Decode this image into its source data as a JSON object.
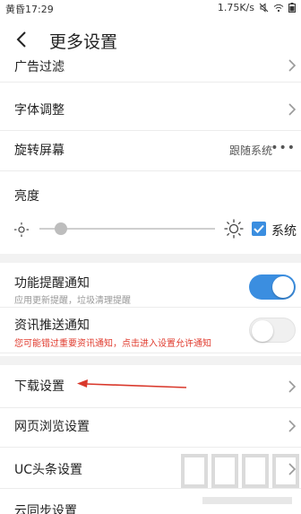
{
  "status_bar": {
    "time": "黄昏17:29",
    "speed": "1.75K/s"
  },
  "header": {
    "title": "更多设置"
  },
  "rows_top": [
    {
      "label": "广告过滤"
    },
    {
      "label": "字体调整"
    },
    {
      "label": "旋转屏幕",
      "value": "跟随系统",
      "dots": "•••"
    }
  ],
  "brightness": {
    "label": "亮度",
    "level": 0.12,
    "follow_system_label": "系统",
    "follow_system_checked": true
  },
  "toggles": [
    {
      "title": "功能提醒通知",
      "subtitle": "应用更新提醒，垃圾清理提醒",
      "on": true
    },
    {
      "title": "资讯推送通知",
      "subtitle": "您可能错过重要资讯通知，点击进入设置允许通知",
      "on": false
    }
  ],
  "rows_bottom": [
    {
      "label": "下载设置"
    },
    {
      "label": "网页浏览设置"
    },
    {
      "label": "UC头条设置"
    },
    {
      "label": "云同步设置"
    }
  ],
  "colors": {
    "accent": "#3b8ee0",
    "warning": "#e03b2e",
    "annotation": "#d9382b"
  }
}
